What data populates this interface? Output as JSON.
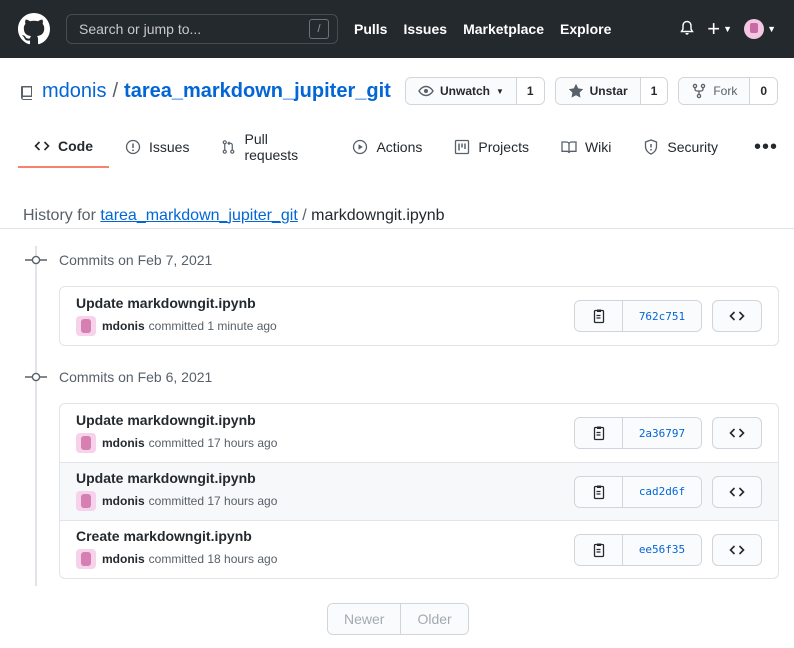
{
  "header": {
    "search_placeholder": "Search or jump to...",
    "slash_key": "/",
    "nav": [
      "Pulls",
      "Issues",
      "Marketplace",
      "Explore"
    ]
  },
  "repo": {
    "owner": "mdonis",
    "separator": "/",
    "name": "tarea_markdown_jupiter_git",
    "watch_label": "Unwatch",
    "watch_count": "1",
    "star_label": "Unstar",
    "star_count": "1",
    "fork_label": "Fork",
    "fork_count": "0"
  },
  "tabs": [
    "Code",
    "Issues",
    "Pull requests",
    "Actions",
    "Projects",
    "Wiki",
    "Security"
  ],
  "tab_more": "•••",
  "history": {
    "prefix": "History for",
    "repo_link": "tarea_markdown_jupiter_git",
    "separator": "/",
    "file": "markdowngit.ipynb"
  },
  "groups": [
    {
      "heading": "Commits on Feb 7, 2021",
      "commits": [
        {
          "title": "Update markdowngit.ipynb",
          "user": "mdonis",
          "time": "committed 1 minute ago",
          "sha": "762c751"
        }
      ]
    },
    {
      "heading": "Commits on Feb 6, 2021",
      "commits": [
        {
          "title": "Update markdowngit.ipynb",
          "user": "mdonis",
          "time": "committed 17 hours ago",
          "sha": "2a36797"
        },
        {
          "title": "Update markdowngit.ipynb",
          "user": "mdonis",
          "time": "committed 17 hours ago",
          "sha": "cad2d6f"
        },
        {
          "title": "Create markdowngit.ipynb",
          "user": "mdonis",
          "time": "committed 18 hours ago",
          "sha": "ee56f35"
        }
      ]
    }
  ],
  "pager": {
    "newer": "Newer",
    "older": "Older"
  },
  "colors": {
    "header_bg": "#24292e",
    "link": "#0366d6",
    "active_tab": "#f9826c"
  }
}
